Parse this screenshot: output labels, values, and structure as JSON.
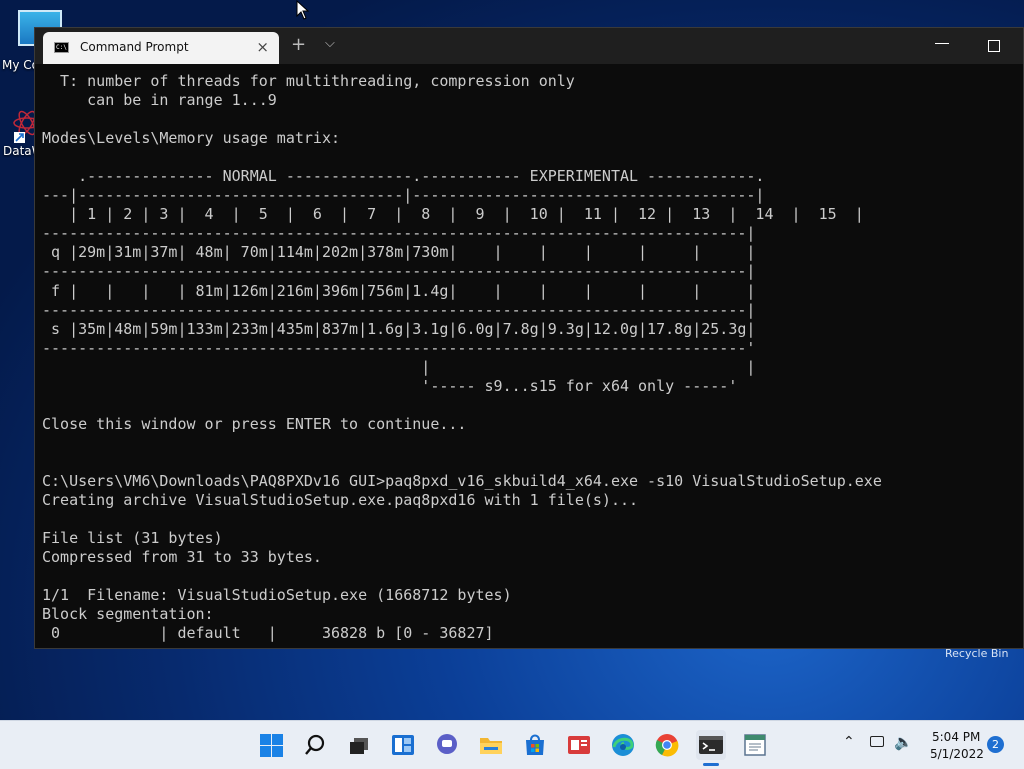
{
  "desktop": {
    "icons": [
      {
        "label": "My Co"
      },
      {
        "label": "DataW"
      }
    ],
    "recycle_bin_label": "Recycle Bin"
  },
  "window": {
    "tab_title": "Command Prompt",
    "tab_icon_text": "C:\\",
    "close_symbol": "×",
    "new_tab_symbol": "+",
    "dropdown_symbol": "⌵"
  },
  "terminal": {
    "lines": [
      "  T: number of threads for multithreading, compression only",
      "     can be in range 1...9",
      "",
      "Modes\\Levels\\Memory usage matrix:",
      "",
      "    .-------------- NORMAL --------------.----------- EXPERIMENTAL ------------.",
      "---|------------------------------------|--------------------------------------|",
      "   | 1 | 2 | 3 |  4  |  5  |  6  |  7  |  8  |  9  |  10 |  11 |  12 |  13  |  14  |  15  |",
      "------------------------------------------------------------------------------|",
      " q |29m|31m|37m| 48m| 70m|114m|202m|378m|730m|    |    |    |     |     |     |",
      "------------------------------------------------------------------------------|",
      " f |   |   |   | 81m|126m|216m|396m|756m|1.4g|    |    |    |     |     |     |",
      "------------------------------------------------------------------------------|",
      " s |35m|48m|59m|133m|233m|435m|837m|1.6g|3.1g|6.0g|7.8g|9.3g|12.0g|17.8g|25.3g|",
      "------------------------------------------------------------------------------'",
      "                                          |                                   |",
      "                                          '----- s9...s15 for x64 only -----'",
      "",
      "Close this window or press ENTER to continue...",
      "",
      "",
      "C:\\Users\\VM6\\Downloads\\PAQ8PXDv16 GUI>paq8pxd_v16_skbuild4_x64.exe -s10 VisualStudioSetup.exe",
      "Creating archive VisualStudioSetup.exe.paq8pxd16 with 1 file(s)...",
      "",
      "File list (31 bytes)",
      "Compressed from 31 to 33 bytes.",
      "",
      "1/1  Filename: VisualStudioSetup.exe (1668712 bytes)",
      "Block segmentation:",
      " 0           | default   |     36828 b [0 - 36827]"
    ]
  },
  "taskbar": {
    "time": "5:04 PM",
    "date": "5/1/2022",
    "notification_count": "2"
  },
  "colors": {
    "terminal_bg": "#0c0c0c",
    "terminal_text": "#cccccc",
    "accent": "#1f6fd1"
  }
}
